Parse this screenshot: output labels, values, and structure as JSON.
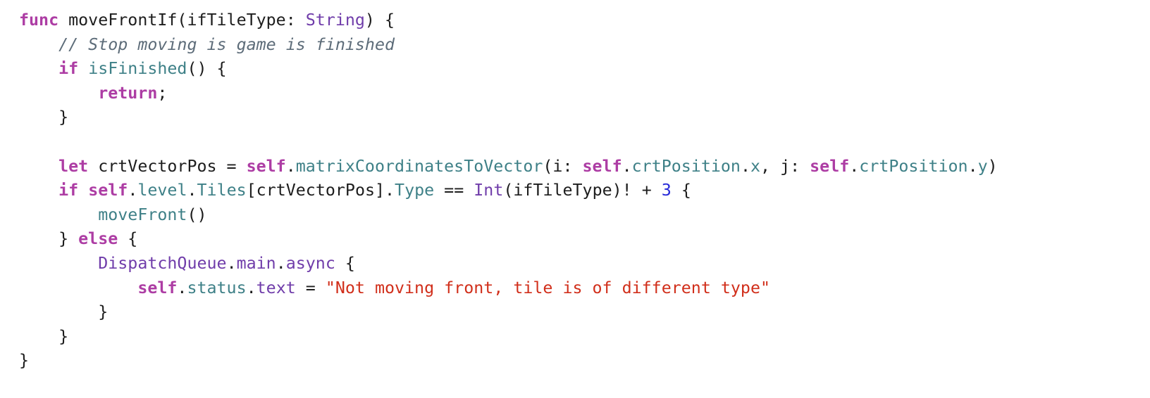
{
  "colors": {
    "keyword": "#ad3da4",
    "type": "#703daa",
    "property": "#3e8087",
    "function": "#3e8087",
    "number": "#272ad8",
    "string": "#d12f1b",
    "comment": "#5d6c79",
    "plain": "#1d1d1d",
    "background": "#ffffff"
  },
  "code": {
    "language": "swift",
    "lines": [
      [
        {
          "t": "kw",
          "v": "func"
        },
        {
          "t": "pl",
          "v": " moveFrontIf(ifTileType: "
        },
        {
          "t": "ty",
          "v": "String"
        },
        {
          "t": "pl",
          "v": ") {"
        }
      ],
      [
        {
          "t": "pl",
          "v": "    "
        },
        {
          "t": "cm",
          "v": "// Stop moving is game is finished"
        }
      ],
      [
        {
          "t": "pl",
          "v": "    "
        },
        {
          "t": "kw",
          "v": "if"
        },
        {
          "t": "pl",
          "v": " "
        },
        {
          "t": "fn",
          "v": "isFinished"
        },
        {
          "t": "pl",
          "v": "() {"
        }
      ],
      [
        {
          "t": "pl",
          "v": "        "
        },
        {
          "t": "kw",
          "v": "return"
        },
        {
          "t": "pl",
          "v": ";"
        }
      ],
      [
        {
          "t": "pl",
          "v": "    }"
        }
      ],
      [],
      [
        {
          "t": "pl",
          "v": "    "
        },
        {
          "t": "kw",
          "v": "let"
        },
        {
          "t": "pl",
          "v": " crtVectorPos = "
        },
        {
          "t": "kw",
          "v": "self"
        },
        {
          "t": "pl",
          "v": "."
        },
        {
          "t": "fn",
          "v": "matrixCoordinatesToVector"
        },
        {
          "t": "pl",
          "v": "(i: "
        },
        {
          "t": "kw",
          "v": "self"
        },
        {
          "t": "pl",
          "v": "."
        },
        {
          "t": "pr",
          "v": "crtPosition"
        },
        {
          "t": "pl",
          "v": "."
        },
        {
          "t": "pr",
          "v": "x"
        },
        {
          "t": "pl",
          "v": ", j: "
        },
        {
          "t": "kw",
          "v": "self"
        },
        {
          "t": "pl",
          "v": "."
        },
        {
          "t": "pr",
          "v": "crtPosition"
        },
        {
          "t": "pl",
          "v": "."
        },
        {
          "t": "pr",
          "v": "y"
        },
        {
          "t": "pl",
          "v": ")"
        }
      ],
      [
        {
          "t": "pl",
          "v": "    "
        },
        {
          "t": "kw",
          "v": "if"
        },
        {
          "t": "pl",
          "v": " "
        },
        {
          "t": "kw",
          "v": "self"
        },
        {
          "t": "pl",
          "v": "."
        },
        {
          "t": "pr",
          "v": "level"
        },
        {
          "t": "pl",
          "v": "."
        },
        {
          "t": "pr",
          "v": "Tiles"
        },
        {
          "t": "pl",
          "v": "[crtVectorPos]."
        },
        {
          "t": "pr",
          "v": "Type"
        },
        {
          "t": "pl",
          "v": " == "
        },
        {
          "t": "ty",
          "v": "Int"
        },
        {
          "t": "pl",
          "v": "(ifTileType)! + "
        },
        {
          "t": "num",
          "v": "3"
        },
        {
          "t": "pl",
          "v": " {"
        }
      ],
      [
        {
          "t": "pl",
          "v": "        "
        },
        {
          "t": "fn",
          "v": "moveFront"
        },
        {
          "t": "pl",
          "v": "()"
        }
      ],
      [
        {
          "t": "pl",
          "v": "    } "
        },
        {
          "t": "kw",
          "v": "else"
        },
        {
          "t": "pl",
          "v": " {"
        }
      ],
      [
        {
          "t": "pl",
          "v": "        "
        },
        {
          "t": "ty",
          "v": "DispatchQueue"
        },
        {
          "t": "pl",
          "v": "."
        },
        {
          "t": "ty",
          "v": "main"
        },
        {
          "t": "pl",
          "v": "."
        },
        {
          "t": "ty",
          "v": "async"
        },
        {
          "t": "pl",
          "v": " {"
        }
      ],
      [
        {
          "t": "pl",
          "v": "            "
        },
        {
          "t": "kw",
          "v": "self"
        },
        {
          "t": "pl",
          "v": "."
        },
        {
          "t": "pr",
          "v": "status"
        },
        {
          "t": "pl",
          "v": "."
        },
        {
          "t": "ty",
          "v": "text"
        },
        {
          "t": "pl",
          "v": " = "
        },
        {
          "t": "str",
          "v": "\"Not moving front, tile is of different type\""
        }
      ],
      [
        {
          "t": "pl",
          "v": "        }"
        }
      ],
      [
        {
          "t": "pl",
          "v": "    }"
        }
      ],
      [
        {
          "t": "pl",
          "v": "}"
        }
      ]
    ]
  }
}
